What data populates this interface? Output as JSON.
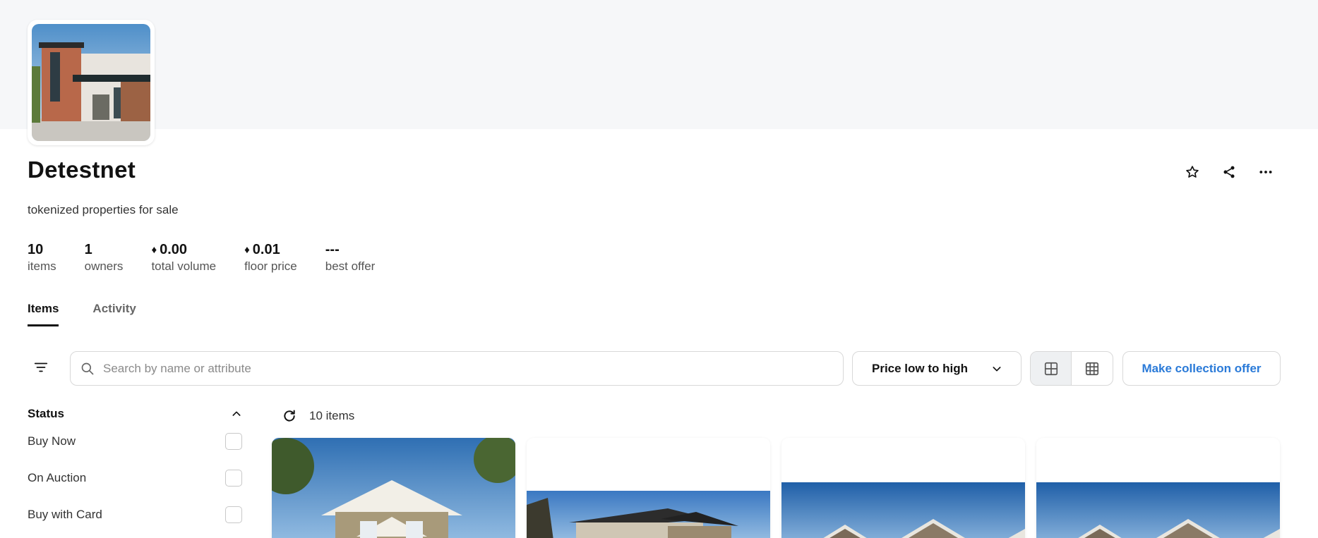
{
  "collection": {
    "name": "Detestnet",
    "description": "tokenized properties for sale"
  },
  "stats": [
    {
      "value": "10",
      "label": "items",
      "eth": false
    },
    {
      "value": "1",
      "label": "owners",
      "eth": false
    },
    {
      "value": "0.00",
      "label": "total volume",
      "eth": true
    },
    {
      "value": "0.01",
      "label": "floor price",
      "eth": true
    },
    {
      "value": "---",
      "label": "best offer",
      "eth": false
    }
  ],
  "tabs": [
    {
      "label": "Items",
      "active": true
    },
    {
      "label": "Activity",
      "active": false
    }
  ],
  "toolbar": {
    "search_placeholder": "Search by name or attribute",
    "sort_label": "Price low to high",
    "offer_label": "Make collection offer"
  },
  "sidebar": {
    "section_title": "Status",
    "options": [
      {
        "label": "Buy Now",
        "checked": false
      },
      {
        "label": "On Auction",
        "checked": false
      },
      {
        "label": "Buy with Card",
        "checked": false
      }
    ]
  },
  "results": {
    "count_label": "10 items"
  },
  "icons": {
    "favorite": "star-icon",
    "share": "share-icon",
    "more": "more-icon",
    "filter": "filter-icon",
    "search": "search-icon",
    "sort": "chevron-down-icon",
    "view_large": "grid-large-icon",
    "view_small": "grid-small-icon",
    "refresh": "refresh-icon",
    "collapse": "chevron-up-icon"
  },
  "colors": {
    "accent": "#2a7ad8",
    "banner": "#f6f7f9"
  }
}
